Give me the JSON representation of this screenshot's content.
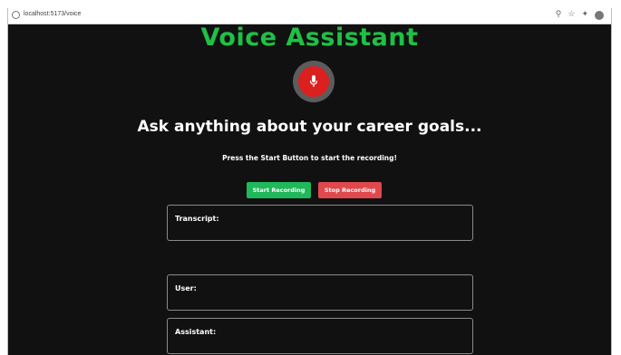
{
  "browser": {
    "url": "localhost:5173/voice"
  },
  "page": {
    "title": "Voice Assistant",
    "heading": "Ask anything about your career goals...",
    "hint": "Press the Start Button to start the recording!",
    "mic_icon": "microphone-icon"
  },
  "controls": {
    "start_label": "Start Recording",
    "stop_label": "Stop Recording"
  },
  "panels": {
    "transcript_label": "Transcript:",
    "user_label": "User:",
    "assistant_label": "Assistant:"
  },
  "colors": {
    "background": "#111111",
    "title": "#1fc145",
    "mic": "#dc1f1f",
    "start_button": "#1fb85a",
    "stop_button": "#e0484c"
  }
}
